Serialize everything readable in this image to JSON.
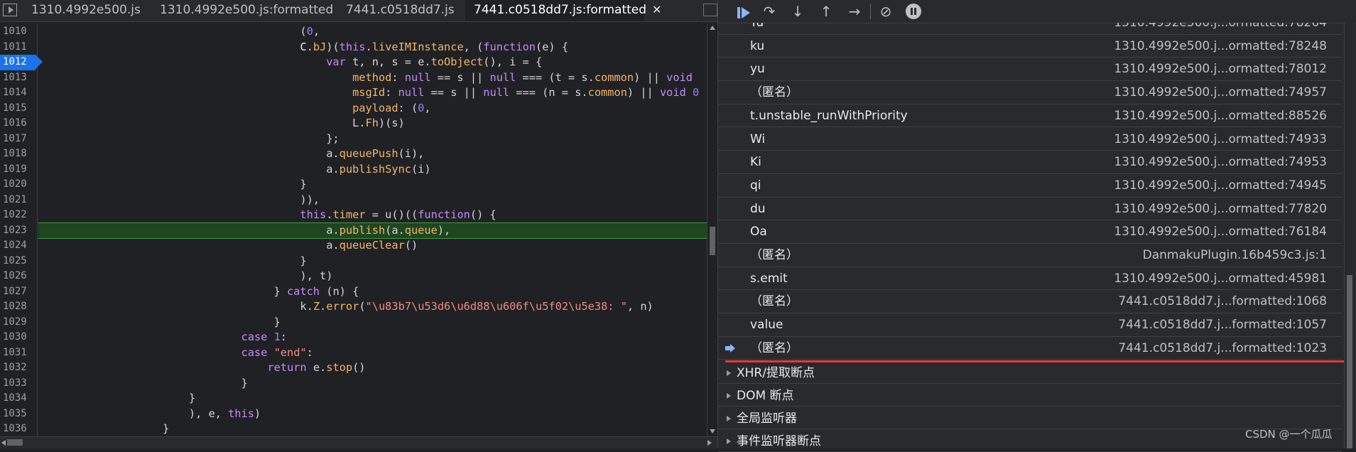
{
  "tabs": [
    {
      "label": "1310.4992e500.js",
      "active": false
    },
    {
      "label": "1310.4992e500.js:formatted",
      "active": false
    },
    {
      "label": "7441.c0518dd7.js",
      "active": false
    },
    {
      "label": "7441.c0518dd7.js:formatted",
      "active": true
    }
  ],
  "tab_close_glyph": "✕",
  "editor": {
    "breakpoint_line": "1012",
    "current_line": "1023",
    "line_numbers": [
      "1010",
      "1011",
      "1012",
      "1013",
      "1014",
      "1015",
      "1016",
      "1017",
      "1018",
      "1019",
      "1020",
      "1021",
      "1022",
      "1023",
      "1024",
      "1025",
      "1026",
      "1027",
      "1028",
      "1029",
      "1030",
      "1031",
      "1032",
      "1033",
      "1034",
      "1035",
      "1036"
    ]
  },
  "call_stack": [
    {
      "name": "ku",
      "location": "1310.4992e500.j...ormatted:78248",
      "selected": false
    },
    {
      "name": "yu",
      "location": "1310.4992e500.j...ormatted:78012",
      "selected": false
    },
    {
      "name": "（匿名）",
      "location": "1310.4992e500.j...ormatted:74957",
      "selected": false
    },
    {
      "name": "t.unstable_runWithPriority",
      "location": "1310.4992e500.j...ormatted:88526",
      "selected": false
    },
    {
      "name": "Wi",
      "location": "1310.4992e500.j...ormatted:74933",
      "selected": false
    },
    {
      "name": "Ki",
      "location": "1310.4992e500.j...ormatted:74953",
      "selected": false
    },
    {
      "name": "qi",
      "location": "1310.4992e500.j...ormatted:74945",
      "selected": false
    },
    {
      "name": "du",
      "location": "1310.4992e500.j...ormatted:77820",
      "selected": false
    },
    {
      "name": "Oa",
      "location": "1310.4992e500.j...ormatted:76184",
      "selected": false
    },
    {
      "name": "（匿名）",
      "location": "DanmakuPlugin.16b459c3.js:1",
      "selected": false
    },
    {
      "name": "s.emit",
      "location": "1310.4992e500.j...ormatted:45981",
      "selected": false
    },
    {
      "name": "（匿名）",
      "location": "7441.c0518dd7.j...formatted:1068",
      "selected": false
    },
    {
      "name": "value",
      "location": "7441.c0518dd7.j...formatted:1057",
      "selected": false
    },
    {
      "name": "（匿名）",
      "location": "7441.c0518dd7.j...formatted:1023",
      "selected": true
    }
  ],
  "sections": [
    {
      "label": "XHR/提取断点"
    },
    {
      "label": "DOM 断点"
    },
    {
      "label": "全局监听器"
    },
    {
      "label": "事件监听器断点"
    }
  ],
  "watermark": "CSDN @一个瓜瓜"
}
